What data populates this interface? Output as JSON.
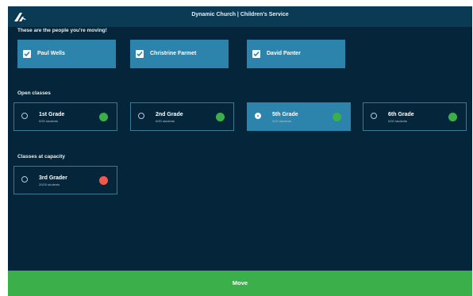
{
  "header": {
    "title": "Dynamic Church | Children's Service",
    "logo_icon": "church-logo-icon"
  },
  "people_section": {
    "label": "These are the people you're moving!",
    "people": [
      {
        "name": "Paul Wells",
        "checked": true
      },
      {
        "name": "Christrine Farmet",
        "checked": true
      },
      {
        "name": "David Panter",
        "checked": true
      }
    ]
  },
  "open_classes": {
    "label": "Open classes",
    "classes": [
      {
        "name": "1st Grade",
        "count": "0/20 students",
        "selected": false,
        "status_color": "#3bb04a"
      },
      {
        "name": "2nd Grade",
        "count": "0/20 students",
        "selected": false,
        "status_color": "#3bb04a"
      },
      {
        "name": "5th Grade",
        "count": "0/20 students",
        "selected": true,
        "status_color": "#3bb04a"
      },
      {
        "name": "6th Grade",
        "count": "0/20 students",
        "selected": false,
        "status_color": "#3bb04a"
      }
    ]
  },
  "capacity_classes": {
    "label": "Classes at capacity",
    "classes": [
      {
        "name": "3rd Grader",
        "count": "20/20 students",
        "selected": false,
        "status_color": "#f05a4a"
      }
    ]
  },
  "actions": {
    "move_label": "Move"
  },
  "colors": {
    "background": "#05263a",
    "header": "#0b3a55",
    "accent": "#2c83ab",
    "success": "#3bb04a",
    "danger": "#f05a4a"
  }
}
